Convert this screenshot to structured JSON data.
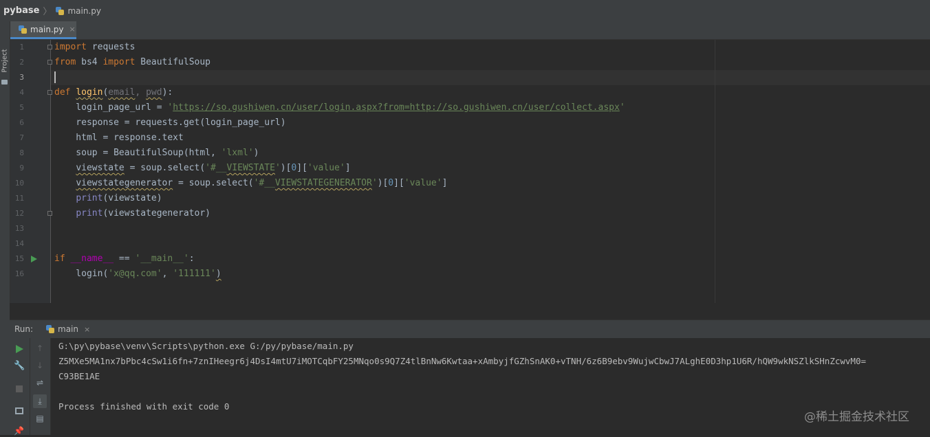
{
  "breadcrumb": {
    "project": "pybase",
    "separator": "〉",
    "file": "main.py"
  },
  "left_strip": {
    "project_label": "Project"
  },
  "editor_tab": {
    "label": "main.py",
    "close": "×"
  },
  "editor": {
    "line_numbers": [
      "1",
      "2",
      "3",
      "4",
      "5",
      "6",
      "7",
      "8",
      "9",
      "10",
      "11",
      "12",
      "13",
      "14",
      "15",
      "16"
    ],
    "lines": [
      [
        {
          "t": "import",
          "c": "kw"
        },
        {
          "t": " requests",
          "c": ""
        }
      ],
      [
        {
          "t": "from",
          "c": "kw"
        },
        {
          "t": " bs4 ",
          "c": ""
        },
        {
          "t": "import",
          "c": "kw"
        },
        {
          "t": " BeautifulSoup",
          "c": ""
        }
      ],
      [],
      [
        {
          "t": "def ",
          "c": "kw"
        },
        {
          "t": "login",
          "c": "fn wavy"
        },
        {
          "t": "(",
          "c": ""
        },
        {
          "t": "email",
          "c": "param wavy"
        },
        {
          "t": ", ",
          "c": "param"
        },
        {
          "t": "pwd",
          "c": "param wavy"
        },
        {
          "t": "):",
          "c": ""
        }
      ],
      [
        {
          "t": "    login_page_url = ",
          "c": ""
        },
        {
          "t": "'",
          "c": "str"
        },
        {
          "t": "https://so.gushiwen.cn/user/login.aspx?from=http://so.gushiwen.cn/user/collect.aspx",
          "c": "str link"
        },
        {
          "t": "'",
          "c": "str"
        }
      ],
      [
        {
          "t": "    response = requests.get(login_page_url)",
          "c": ""
        }
      ],
      [
        {
          "t": "    html = response.text",
          "c": ""
        }
      ],
      [
        {
          "t": "    soup = BeautifulSoup(html, ",
          "c": ""
        },
        {
          "t": "'lxml'",
          "c": "str"
        },
        {
          "t": ")",
          "c": ""
        }
      ],
      [
        {
          "t": "    ",
          "c": ""
        },
        {
          "t": "viewstate",
          "c": "wavy"
        },
        {
          "t": " = soup.select(",
          "c": ""
        },
        {
          "t": "'#__",
          "c": "str"
        },
        {
          "t": "VIEWSTATE",
          "c": "str wavy"
        },
        {
          "t": "'",
          "c": "str"
        },
        {
          "t": ")[",
          "c": ""
        },
        {
          "t": "0",
          "c": "num"
        },
        {
          "t": "][",
          "c": ""
        },
        {
          "t": "'value'",
          "c": "str"
        },
        {
          "t": "]",
          "c": ""
        }
      ],
      [
        {
          "t": "    ",
          "c": ""
        },
        {
          "t": "viewstategenerator",
          "c": "wavy"
        },
        {
          "t": " = soup.select(",
          "c": ""
        },
        {
          "t": "'#__",
          "c": "str"
        },
        {
          "t": "VIEWSTATEGENERATOR",
          "c": "str wavy"
        },
        {
          "t": "'",
          "c": "str"
        },
        {
          "t": ")[",
          "c": ""
        },
        {
          "t": "0",
          "c": "num"
        },
        {
          "t": "][",
          "c": ""
        },
        {
          "t": "'value'",
          "c": "str"
        },
        {
          "t": "]",
          "c": ""
        }
      ],
      [
        {
          "t": "    ",
          "c": ""
        },
        {
          "t": "print",
          "c": "bi"
        },
        {
          "t": "(viewstate)",
          "c": ""
        }
      ],
      [
        {
          "t": "    ",
          "c": ""
        },
        {
          "t": "print",
          "c": "bi"
        },
        {
          "t": "(viewstategenerator)",
          "c": ""
        }
      ],
      [],
      [],
      [
        {
          "t": "if ",
          "c": "kw"
        },
        {
          "t": "__name__",
          "c": "dunder"
        },
        {
          "t": " == ",
          "c": ""
        },
        {
          "t": "'__main__'",
          "c": "str"
        },
        {
          "t": ":",
          "c": ""
        }
      ],
      [
        {
          "t": "    login(",
          "c": ""
        },
        {
          "t": "'x@qq.com'",
          "c": "str"
        },
        {
          "t": ", ",
          "c": ""
        },
        {
          "t": "'111111'",
          "c": "str"
        },
        {
          "t": ")",
          "c": "wavy"
        }
      ]
    ]
  },
  "run_panel": {
    "title": "Run:",
    "tab_label": "main",
    "tab_close": "×",
    "output": [
      "G:\\py\\pybase\\venv\\Scripts\\python.exe G:/py/pybase/main.py",
      "Z5MXe5MA1nx7bPbc4cSw1i6fn+7znIHeegr6j4DsI4mtU7iMOTCqbFY25MNqo0s9Q7Z4tlBnNw6Kwtaa+xAmbyjfGZhSnAK0+vTNH/6z6B9ebv9WujwCbwJ7ALghE0D3hp1U6R/hQW9wkNSZlkSHnZcwvM0=",
      "C93BE1AE",
      "",
      "Process finished with exit code 0"
    ]
  },
  "watermark": "@稀土掘金技术社区",
  "colors": {
    "accent": "#4a88c7",
    "run_green": "#499c54",
    "keyword": "#cc7832",
    "string": "#6a8759"
  }
}
